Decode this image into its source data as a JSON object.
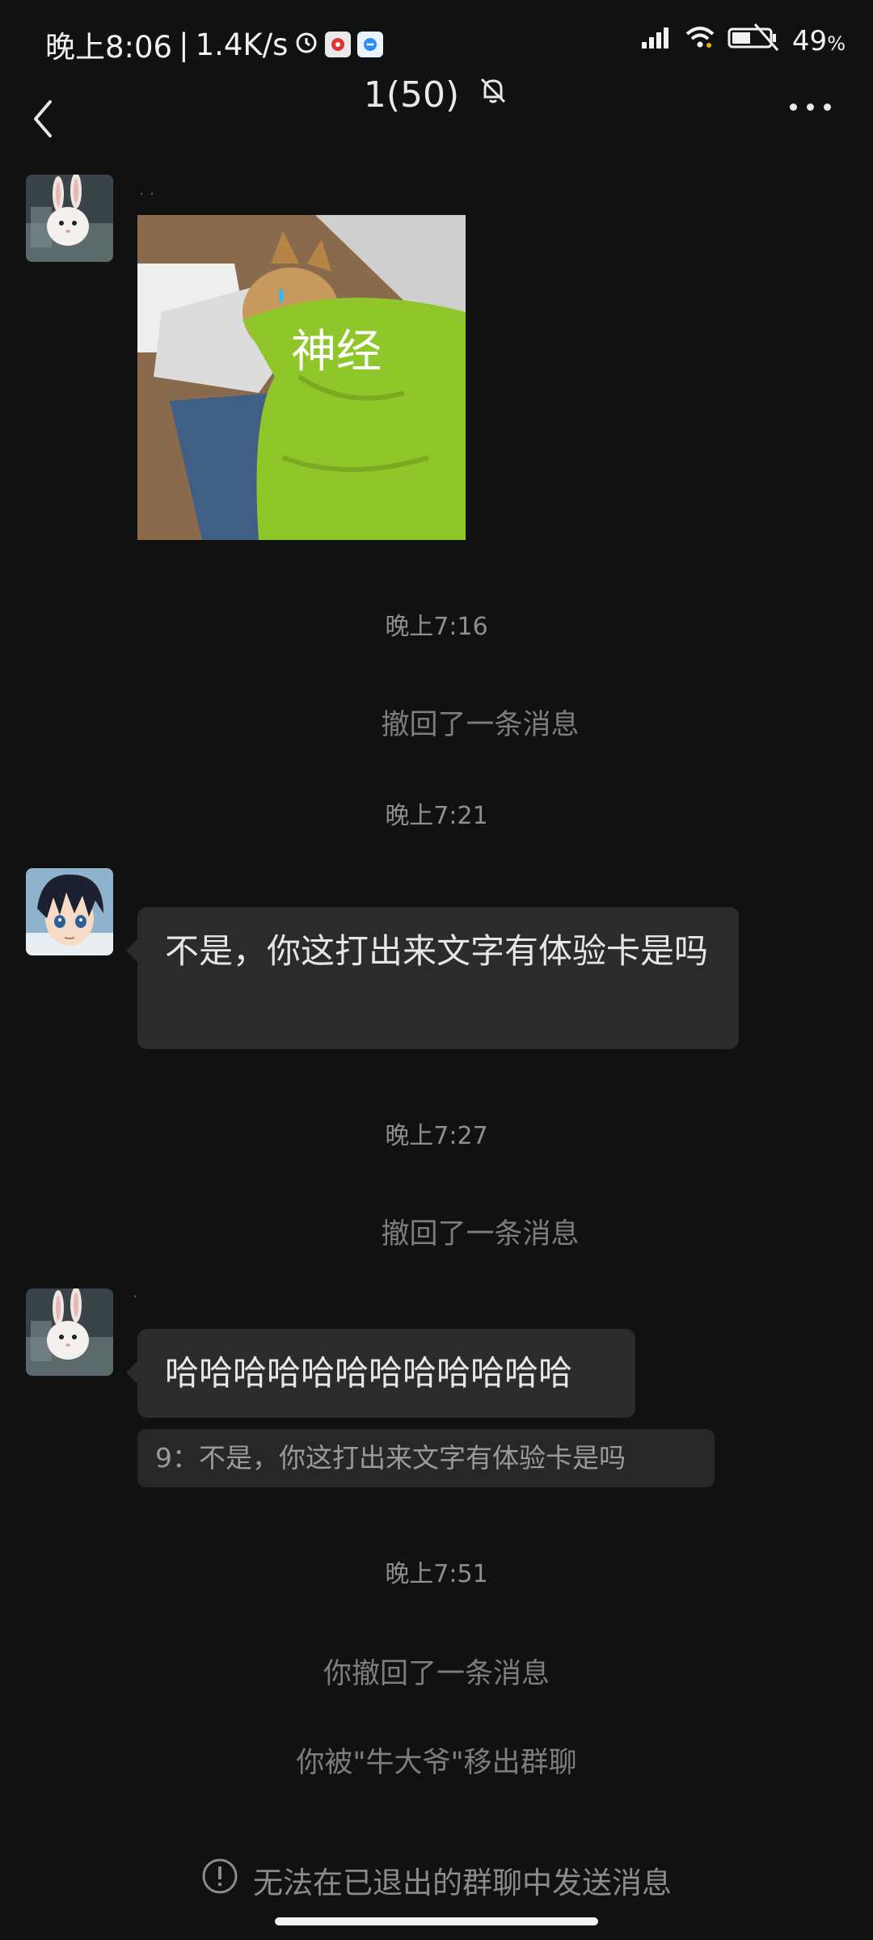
{
  "status_bar": {
    "time": "晚上8:06",
    "speed": "1.4K/s",
    "battery": "49"
  },
  "header": {
    "title": "1(50)",
    "icons": [
      "back-arrow-icon",
      "mute-bell-icon",
      "more-dots-icon"
    ]
  },
  "messages": {
    "sticker_text": "神经",
    "time_1": "晚上7:16",
    "recall_1": "撤回了一条消息",
    "time_2": "晚上7:21",
    "bubble_1": "不是，你这打出来文字有体验卡是吗",
    "time_3": "晚上7:27",
    "recall_2": "撤回了一条消息",
    "bubble_2": "哈哈哈哈哈哈哈哈哈哈哈哈",
    "quote": "9：不是，你这打出来文字有体验卡是吗",
    "time_4": "晚上7:51",
    "self_recall": "你撤回了一条消息",
    "removed": "你被\"牛大爷\"移出群聊"
  },
  "footer": {
    "notice": "无法在已退出的群聊中发送消息"
  },
  "colors": {
    "background": "#111111",
    "bubble": "#2b2b2b",
    "system_text": "#7d7d7d"
  }
}
